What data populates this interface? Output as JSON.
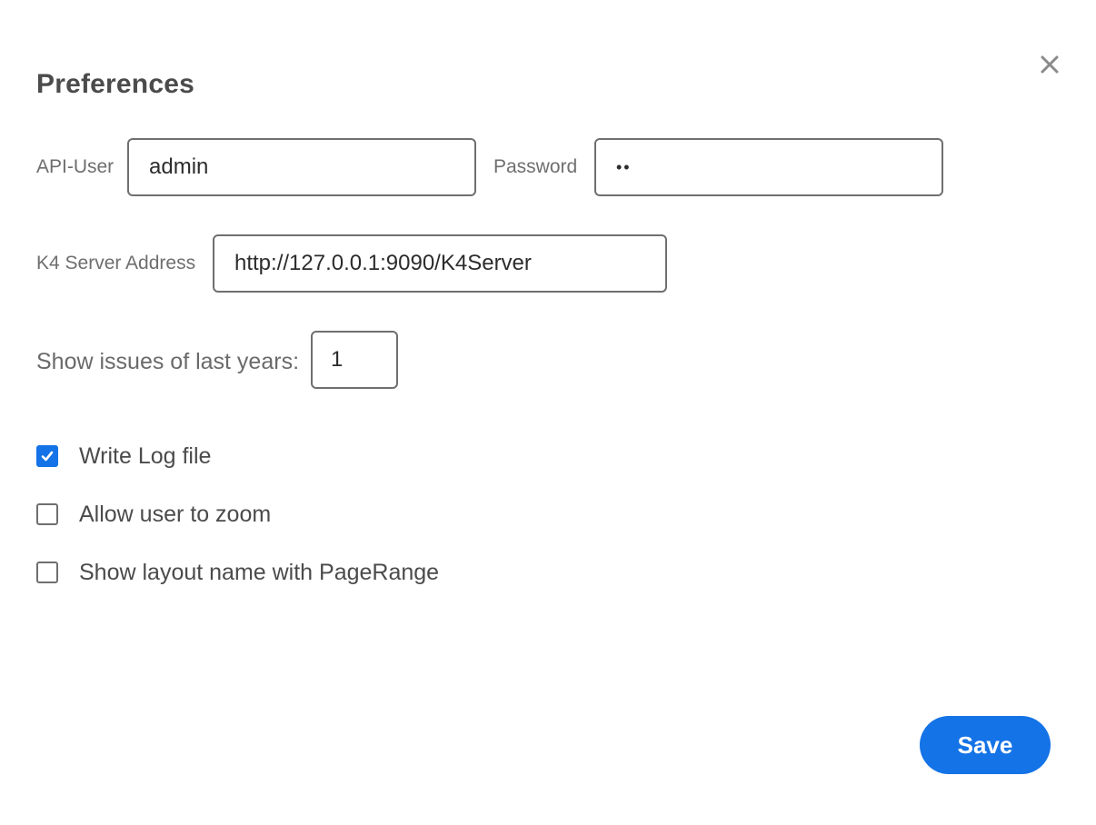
{
  "dialog": {
    "title": "Preferences",
    "close_icon": "close-icon"
  },
  "fields": {
    "api_user_label": "API-User",
    "api_user_value": "admin",
    "password_label": "Password",
    "password_value": "••",
    "server_label": "K4 Server Address",
    "server_value": "http://127.0.0.1:9090/K4Server",
    "years_label": "Show issues of last years:",
    "years_value": "1"
  },
  "options": [
    {
      "label": "Write Log file",
      "checked": true
    },
    {
      "label": "Allow user to zoom",
      "checked": false
    },
    {
      "label": "Show layout name with PageRange",
      "checked": false
    }
  ],
  "actions": {
    "save_label": "Save"
  },
  "colors": {
    "accent": "#1473e6",
    "text": "#4b4b4b",
    "label": "#6e6e6e",
    "border": "#6f6f6f"
  }
}
